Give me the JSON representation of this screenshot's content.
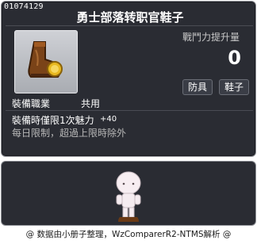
{
  "item": {
    "id": "01074129",
    "name": "勇士部落转职官鞋子",
    "icon": "brown-boots-with-gold-coin-icon"
  },
  "stats": {
    "label": "戰鬥力提升量",
    "value": "0"
  },
  "tags": [
    "防具",
    "鞋子"
  ],
  "job": {
    "label": "裝備職業",
    "value": "共用"
  },
  "effect": {
    "label": "裝備時僅限1次魅力",
    "value": "+40"
  },
  "limit_text": "每日限制，超過上限時除外",
  "preview": {
    "icon": "character-preview-icon"
  },
  "footer": "@ 数据由小册子整理，WzComparerR2-NTMS解析 @",
  "colors": {
    "panel_bg": "#2a2c33",
    "panel_border": "#8e9096",
    "text_primary": "#ffffff",
    "text_secondary": "#b8b8b8"
  }
}
